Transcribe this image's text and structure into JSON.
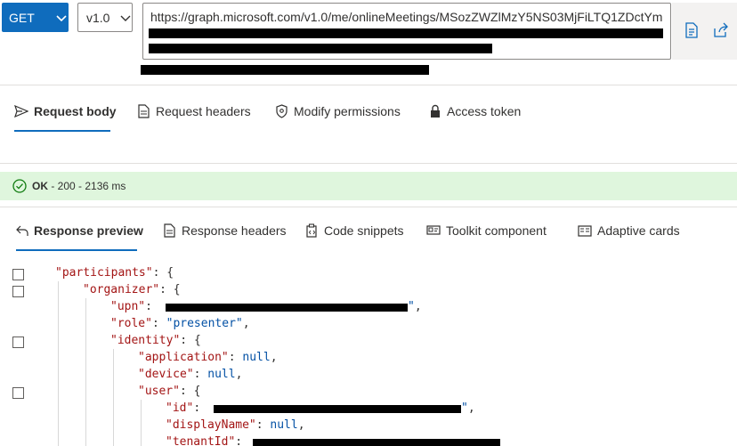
{
  "request": {
    "method": "GET",
    "version": "v1.0",
    "url": "https://graph.microsoft.com/v1.0/me/onlineMeetings/MSozZWZlMzY5NS03MjFiLTQ1ZDctYm"
  },
  "request_tabs": [
    {
      "label": "Request body",
      "icon": "send-icon"
    },
    {
      "label": "Request headers",
      "icon": "document-icon"
    },
    {
      "label": "Modify permissions",
      "icon": "shield-icon"
    },
    {
      "label": "Access token",
      "icon": "lock-icon"
    }
  ],
  "status": {
    "ok": "OK",
    "detail": " - 200 - 2136 ms",
    "color": "#dff6dd"
  },
  "response_tabs": [
    {
      "label": "Response preview",
      "icon": "undo-arrow-icon"
    },
    {
      "label": "Response headers",
      "icon": "document-icon"
    },
    {
      "label": "Code snippets",
      "icon": "clipboard-icon"
    },
    {
      "label": "Toolkit component",
      "icon": "toolkit-icon"
    },
    {
      "label": "Adaptive cards",
      "icon": "card-icon"
    }
  ],
  "json_lines": {
    "participants_key": "\"participants\"",
    "organizer_key": "\"organizer\"",
    "upn_key": "\"upn\"",
    "role_key": "\"role\"",
    "role_value": "\"presenter\"",
    "identity_key": "\"identity\"",
    "application_key": "\"application\"",
    "device_key": "\"device\"",
    "user_key": "\"user\"",
    "id_key": "\"id\"",
    "displayName_key": "\"displayName\"",
    "tenantId_key": "\"tenantId\"",
    "null_value": "null",
    "open_brace": "{",
    "colon": ": ",
    "comma": ","
  },
  "accent_color": "#0f6cbd"
}
